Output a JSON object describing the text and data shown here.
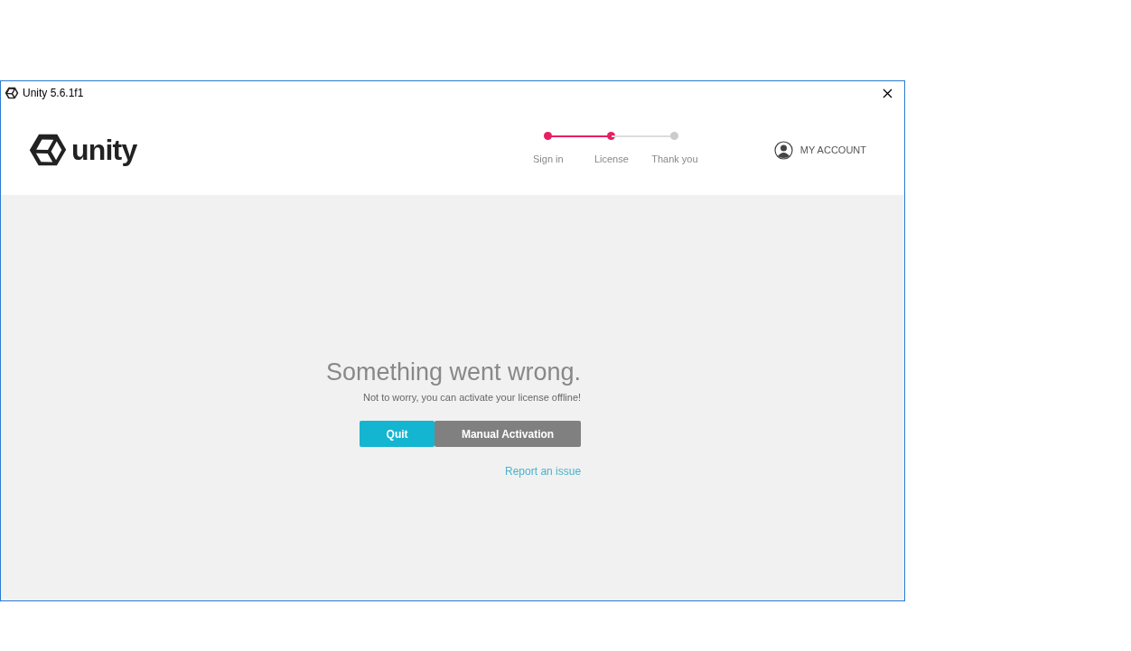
{
  "window": {
    "title": "Unity 5.6.1f1"
  },
  "header": {
    "logo_text": "unity",
    "steps": [
      {
        "label": "Sign in",
        "reached": true
      },
      {
        "label": "License",
        "reached": true
      },
      {
        "label": "Thank you",
        "reached": false
      }
    ],
    "account": "MY ACCOUNT"
  },
  "message": {
    "title": "Something went wrong.",
    "subtitle": "Not to worry, you can activate your license offline!"
  },
  "buttons": [
    {
      "label": "Quit",
      "kind": "primary"
    },
    {
      "label": "Manual Activation",
      "kind": "secondary"
    }
  ],
  "link": "Report an issue"
}
